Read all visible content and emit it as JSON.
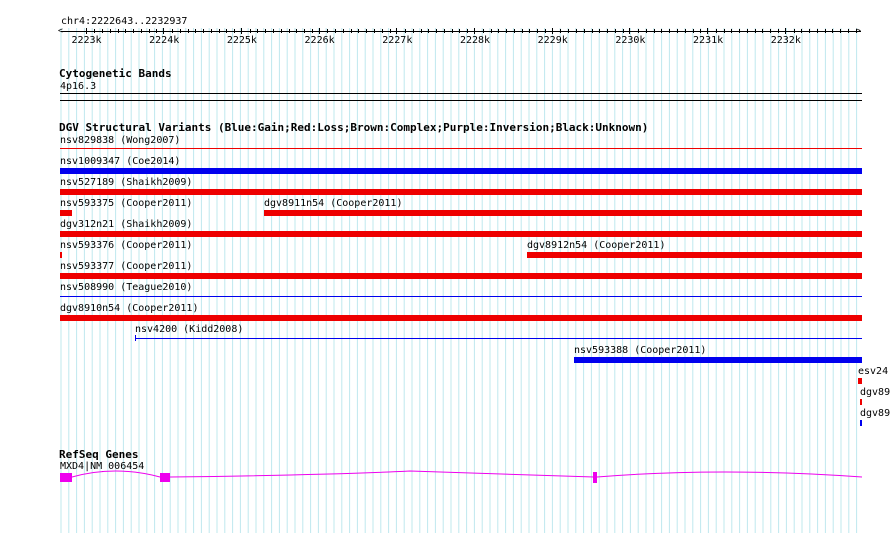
{
  "ruler": {
    "location": "chr4:2222643..2232937",
    "ticks": [
      "2223k",
      "2224k",
      "2225k",
      "2226k",
      "2227k",
      "2228k",
      "2229k",
      "2230k",
      "2231k",
      "2232k"
    ]
  },
  "cytobands": {
    "title": "Cytogenetic Bands",
    "band": "4p16.3"
  },
  "dgv": {
    "title": "DGV Structural Variants (Blue:Gain;Red:Loss;Brown:Complex;Purple:Inversion;Black:Unknown)",
    "colors": {
      "gain": "#0000ee",
      "loss": "#ee0000"
    },
    "features": [
      {
        "label": "nsv829838 (Wong2007)",
        "type": "loss",
        "style": "thin"
      },
      {
        "label": "nsv1009347 (Coe2014)",
        "type": "gain",
        "style": "thick"
      },
      {
        "label": "nsv527189 (Shaikh2009)",
        "type": "loss",
        "style": "thick"
      },
      {
        "label": "nsv593375 (Cooper2011)",
        "type": "loss",
        "style": "thick"
      },
      {
        "label": "dgv8911n54 (Cooper2011)",
        "type": "loss",
        "style": "thick"
      },
      {
        "label": "dgv312n21 (Shaikh2009)",
        "type": "loss",
        "style": "thick"
      },
      {
        "label": "nsv593376 (Cooper2011)",
        "type": "loss",
        "style": "thick"
      },
      {
        "label": "dgv8912n54 (Cooper2011)",
        "type": "loss",
        "style": "thick"
      },
      {
        "label": "nsv593377 (Cooper2011)",
        "type": "loss",
        "style": "thick"
      },
      {
        "label": "nsv508990 (Teague2010)",
        "type": "gain",
        "style": "thin"
      },
      {
        "label": "dgv8910n54 (Cooper2011)",
        "type": "loss",
        "style": "thick"
      },
      {
        "label": "nsv4200 (Kidd2008)",
        "type": "gain",
        "style": "thin"
      },
      {
        "label": "nsv593388 (Cooper2011)",
        "type": "gain",
        "style": "thick"
      },
      {
        "label": "esv24",
        "type": "loss",
        "style": "thick"
      },
      {
        "label": "dgv89",
        "type": "loss",
        "style": "thick"
      },
      {
        "label": "dgv89",
        "type": "gain",
        "style": "thick"
      }
    ]
  },
  "refseq": {
    "title": "RefSeq Genes",
    "gene": "MXD4|NM_006454",
    "color": "#ee00ee"
  }
}
